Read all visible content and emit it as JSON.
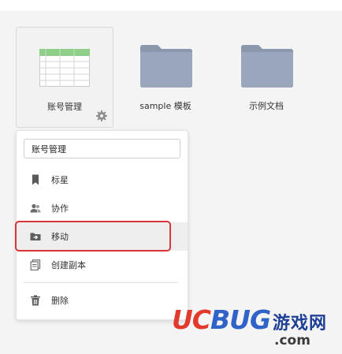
{
  "files": [
    {
      "name": "账号管理",
      "type": "spreadsheet",
      "selected": true
    },
    {
      "name": "sample 模板",
      "type": "folder",
      "selected": false
    },
    {
      "name": "示例文档",
      "type": "folder",
      "selected": false
    }
  ],
  "context_menu": {
    "rename_value": "账号管理",
    "items": [
      {
        "label": "标星",
        "icon": "bookmark-icon"
      },
      {
        "label": "协作",
        "icon": "users-icon"
      },
      {
        "label": "移动",
        "icon": "move-folder-icon",
        "hovered": true
      },
      {
        "label": "创建副本",
        "icon": "copy-icon"
      },
      {
        "label": "删除",
        "icon": "trash-icon"
      }
    ]
  },
  "watermark": {
    "uc": "UC",
    "bug": "BUG",
    "cn": "游戏网",
    "com": ".com"
  },
  "colors": {
    "folder": "#9aa6bb",
    "sheet_green": "#8fcf8a",
    "highlight": "#d8363a",
    "watermark_red": "#e33a2e",
    "watermark_blue": "#2f63c8"
  }
}
